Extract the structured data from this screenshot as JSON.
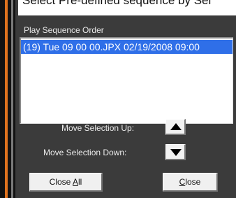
{
  "top_field": {
    "text": "Select Pre-defined sequence by Sel"
  },
  "sequence": {
    "label": "Play Sequence Order",
    "items": [
      "(19) Tue 09 00 00.JPX 02/19/2008 09:00"
    ]
  },
  "controls": {
    "move_up_label": "Move Selection Up:",
    "move_down_label": "Move Selection Down:",
    "move_up_icon": "triangle-up",
    "move_down_icon": "triangle-down"
  },
  "buttons": {
    "close_all_prefix": "Close ",
    "close_all_mnemonic": "A",
    "close_all_suffix": "ll",
    "close_mnemonic": "C",
    "close_suffix": "lose"
  },
  "colors": {
    "accent_orange": "#e0731e",
    "selection_blue": "#2f6fe8",
    "panel_bg": "#3b3b3b"
  }
}
